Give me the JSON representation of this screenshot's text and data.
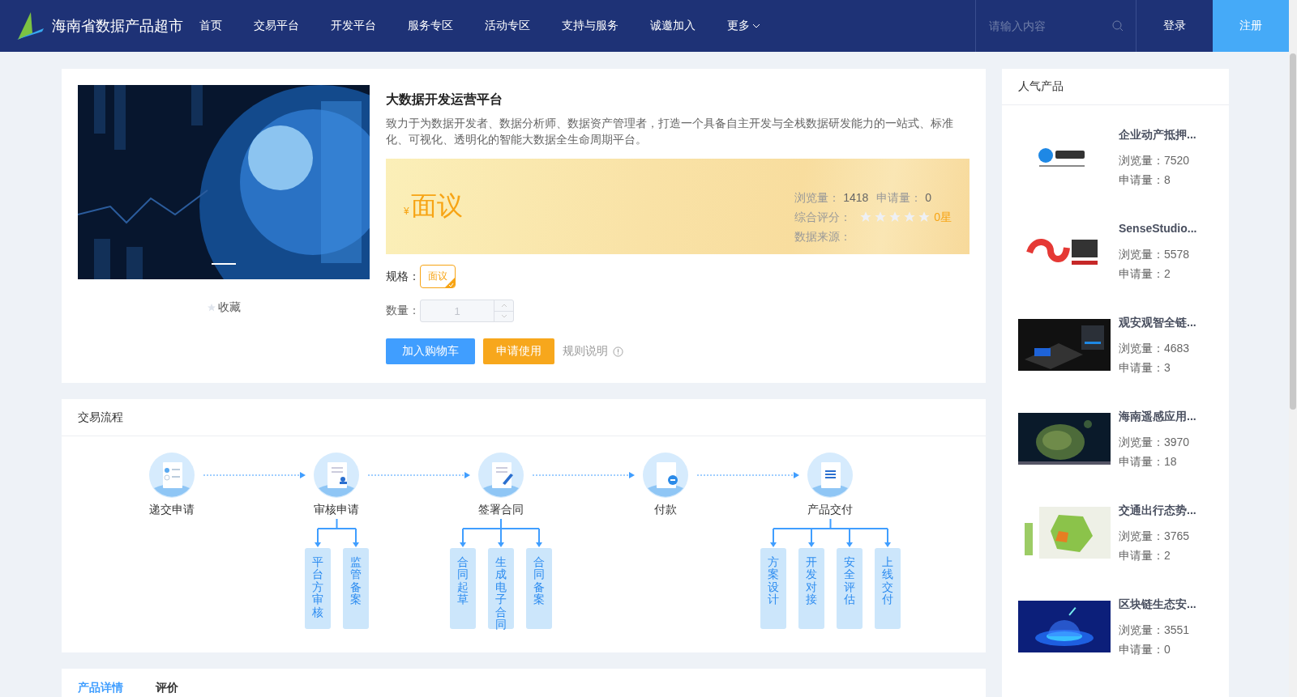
{
  "header": {
    "site_title": "海南省数据产品超市",
    "nav": [
      {
        "label": "首页",
        "has_menu": false
      },
      {
        "label": "交易平台",
        "has_menu": false
      },
      {
        "label": "开发平台",
        "has_menu": false
      },
      {
        "label": "服务专区",
        "has_menu": false
      },
      {
        "label": "活动专区",
        "has_menu": false
      },
      {
        "label": "支持与服务",
        "has_menu": false
      },
      {
        "label": "诚邀加入",
        "has_menu": false
      },
      {
        "label": "更多",
        "has_menu": true
      }
    ],
    "search": {
      "placeholder": "请输入内容"
    },
    "login": "登录",
    "register": "注册"
  },
  "product": {
    "favorite": "收藏",
    "title": "大数据开发运营平台",
    "description": "致力于为数据开发者、数据分析师、数据资产管理者，打造一个具备自主开发与全栈数据研发能力的一站式、标准化、可视化、透明化的智能大数据全生命周期平台。",
    "currency": "¥",
    "price": "面议",
    "views_label": "浏览量：",
    "views": "1418",
    "applies_label": "申请量：",
    "applies": "0",
    "rating_label": "综合评分：",
    "stars": 0,
    "rating_text": "0星",
    "source_label": "数据来源：",
    "spec_label": "规格：",
    "specs": [
      {
        "label": "面议",
        "selected": true
      }
    ],
    "quantity_label": "数量：",
    "quantity": "1",
    "cart_button": "加入购物车",
    "apply_button": "申请使用",
    "rules_link": "规则说明"
  },
  "flow": {
    "title": "交易流程",
    "steps": [
      {
        "label": "递交申请"
      },
      {
        "label": "审核申请",
        "children": [
          "平台方审核",
          "监管备案"
        ]
      },
      {
        "label": "签署合同",
        "children": [
          "合同起草",
          "生成电子合同",
          "合同备案"
        ]
      },
      {
        "label": "付款"
      },
      {
        "label": "产品交付",
        "children": [
          "方案设计",
          "开发对接",
          "安全评估",
          "上线交付"
        ]
      }
    ]
  },
  "tabs": [
    {
      "label": "产品详情",
      "selected": true
    },
    {
      "label": "评价",
      "selected": false
    }
  ],
  "sidebar": {
    "title": "人气产品",
    "items": [
      {
        "title": "企业动产抵押...",
        "views": "浏览量：7520",
        "applies": "申请量：8"
      },
      {
        "title": "SenseStudio...",
        "views": "浏览量：5578",
        "applies": "申请量：2"
      },
      {
        "title": "观安观智全链...",
        "views": "浏览量：4683",
        "applies": "申请量：3"
      },
      {
        "title": "海南遥感应用...",
        "views": "浏览量：3970",
        "applies": "申请量：18"
      },
      {
        "title": "交通出行态势...",
        "views": "浏览量：3765",
        "applies": "申请量：2"
      },
      {
        "title": "区块链生态安...",
        "views": "浏览量：3551",
        "applies": "申请量：0"
      }
    ]
  }
}
